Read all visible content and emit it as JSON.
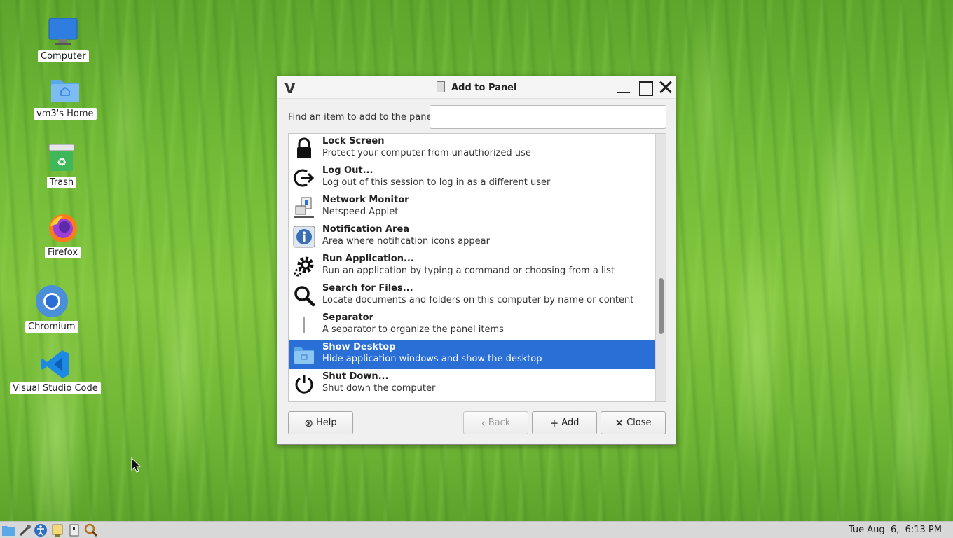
{
  "desktop": {
    "icons": [
      {
        "label": "Computer"
      },
      {
        "label": "vm3's Home"
      },
      {
        "label": "Trash"
      },
      {
        "label": "Firefox"
      },
      {
        "label": "Chromium"
      },
      {
        "label": "Visual Studio Code"
      }
    ]
  },
  "dialog": {
    "title": "Add to Panel",
    "find_label": "Find an item to add to the panel:",
    "search": {
      "value": "",
      "placeholder": ""
    },
    "items": [
      {
        "name": "Lock Screen",
        "description": "Protect your computer from unauthorized use",
        "icon": "lock-icon",
        "selected": false
      },
      {
        "name": "Log Out...",
        "description": "Log out of this session to log in as a different user",
        "icon": "logout-icon",
        "selected": false
      },
      {
        "name": "Network Monitor",
        "description": "Netspeed Applet",
        "icon": "network-monitor-icon",
        "selected": false
      },
      {
        "name": "Notification Area",
        "description": "Area where notification icons appear",
        "icon": "info-icon",
        "selected": false
      },
      {
        "name": "Run Application...",
        "description": "Run an application by typing a command or choosing from a list",
        "icon": "gears-icon",
        "selected": false
      },
      {
        "name": "Search for Files...",
        "description": "Locate documents and folders on this computer by name or content",
        "icon": "search-icon",
        "selected": false
      },
      {
        "name": "Separator",
        "description": "A separator to organize the panel items",
        "icon": "separator-icon",
        "selected": false
      },
      {
        "name": "Show Desktop",
        "description": "Hide application windows and show the desktop",
        "icon": "desktop-folder-icon",
        "selected": true
      },
      {
        "name": "Shut Down...",
        "description": "Shut down the computer",
        "icon": "power-icon",
        "selected": false
      }
    ],
    "buttons": {
      "help": "Help",
      "back": "Back",
      "add": "Add",
      "close": "Close"
    }
  },
  "taskbar": {
    "clock": "Tue Aug  6,  6:13 PM"
  },
  "colors": {
    "selection": "#2a6fd6",
    "desktop_green": "#73bb38"
  }
}
